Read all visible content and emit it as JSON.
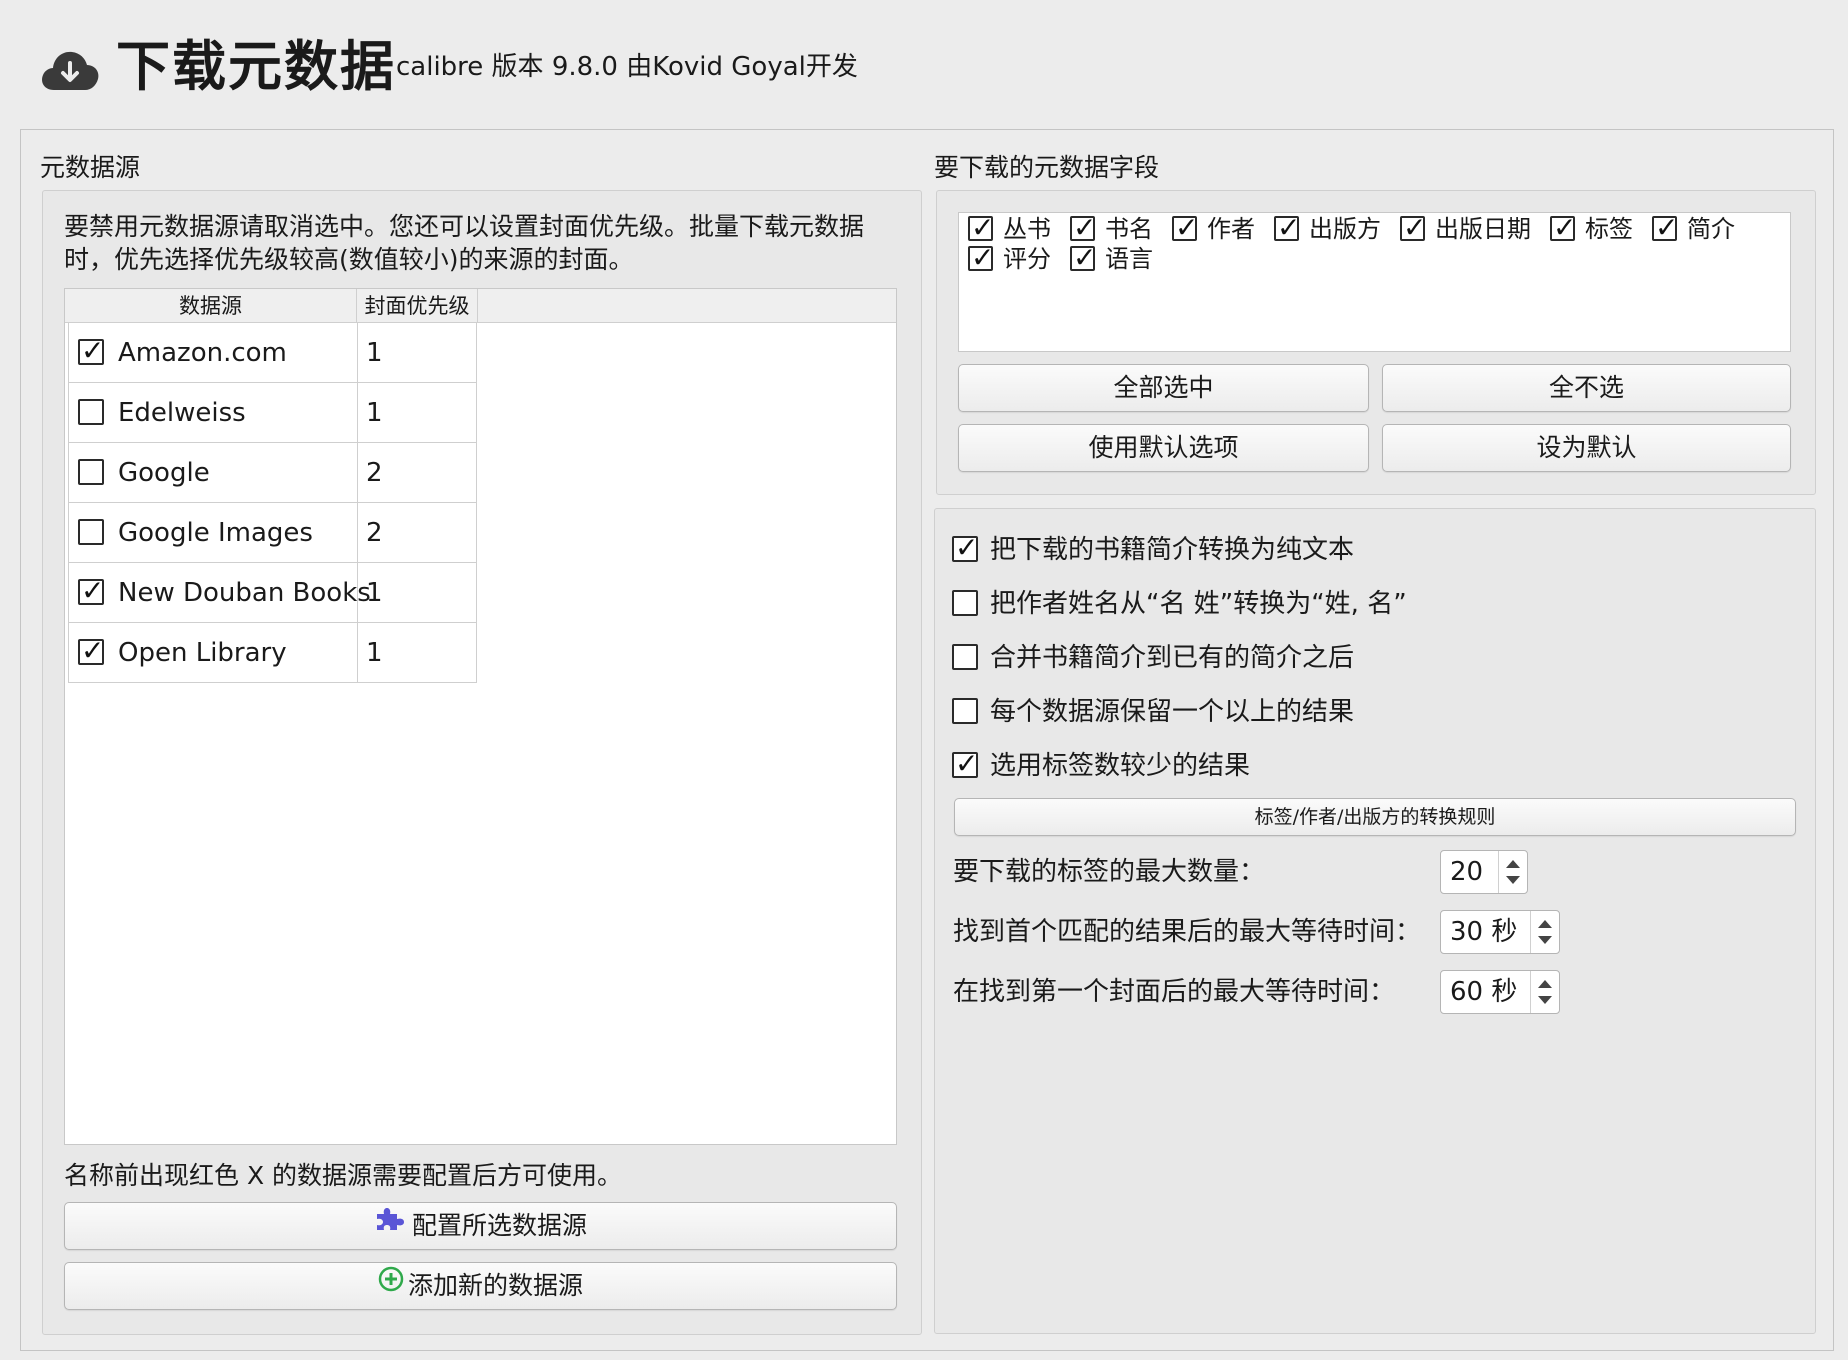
{
  "header": {
    "title": "下载元数据",
    "subtitle": "calibre 版本 9.8.0 由Kovid Goyal开发",
    "icon": "cloud-download-icon"
  },
  "left": {
    "section_title": "元数据源",
    "description": "要禁用元数据源请取消选中。您还可以设置封面优先级。批量下载元数据时，优先选择优先级较高(数值较小)的来源的封面。",
    "table": {
      "columns": [
        "数据源",
        "封面优先级"
      ],
      "rows": [
        {
          "name": "Amazon.com",
          "checked": true,
          "priority": "1"
        },
        {
          "name": "Edelweiss",
          "checked": false,
          "priority": "1"
        },
        {
          "name": "Google",
          "checked": false,
          "priority": "2"
        },
        {
          "name": "Google Images",
          "checked": false,
          "priority": "2"
        },
        {
          "name": "New Douban Books",
          "checked": true,
          "priority": "1"
        },
        {
          "name": "Open Library",
          "checked": true,
          "priority": "1"
        }
      ]
    },
    "note": "名称前出现红色 X 的数据源需要配置后方可使用。",
    "configure_button": "配置所选数据源",
    "add_button": "添加新的数据源",
    "configure_icon": "puzzle-icon",
    "add_icon": "plus-circle-icon"
  },
  "right": {
    "section_title": "要下载的元数据字段",
    "fields": [
      {
        "label": "丛书",
        "checked": true
      },
      {
        "label": "书名",
        "checked": true
      },
      {
        "label": "作者",
        "checked": true
      },
      {
        "label": "出版方",
        "checked": true
      },
      {
        "label": "出版日期",
        "checked": true
      },
      {
        "label": "标签",
        "checked": true
      },
      {
        "label": "简介",
        "checked": true
      },
      {
        "label": "评分",
        "checked": true
      },
      {
        "label": "语言",
        "checked": true
      }
    ],
    "select_all": "全部选中",
    "select_none": "全不选",
    "use_defaults": "使用默认选项",
    "set_default": "设为默认",
    "options": [
      {
        "label": "把下载的书籍简介转换为纯文本",
        "checked": true
      },
      {
        "label": "把作者姓名从“名 姓”转换为“姓, 名”",
        "checked": false
      },
      {
        "label": "合并书籍简介到已有的简介之后",
        "checked": false
      },
      {
        "label": "每个数据源保留一个以上的结果",
        "checked": false
      },
      {
        "label": "选用标签数较少的结果",
        "checked": true
      }
    ],
    "rules_button": "标签/作者/出版方的转换规则",
    "max_tags_label": "要下载的标签的最大数量：",
    "max_tags_value": "20",
    "wait_first_label": "找到首个匹配的结果后的最大等待时间：",
    "wait_first_value": "30 秒",
    "wait_cover_label": "在找到第一个封面后的最大等待时间：",
    "wait_cover_value": "60 秒"
  },
  "colors": {
    "background": "#ececec",
    "puzzle_icon": "#5a55d6",
    "plus_icon": "#2fa94b"
  }
}
